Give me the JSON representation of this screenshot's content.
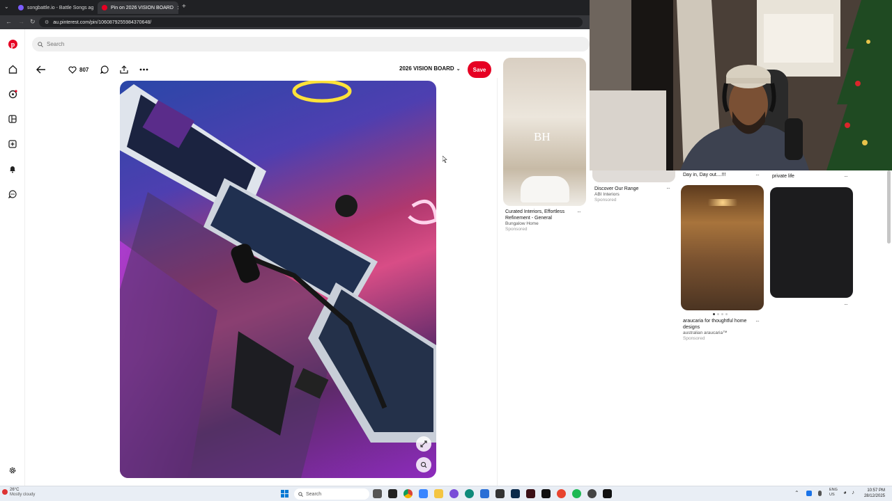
{
  "browser": {
    "tabs": [
      {
        "label": "songbattle.io - Battle Songs ag",
        "active": false,
        "favicon_color": "#7b5cff"
      },
      {
        "label": "Pin on 2026 VISION BOARD",
        "active": true,
        "favicon_color": "#e60023"
      }
    ],
    "url": "au.pinterest.com/pin/1060879255984370648/"
  },
  "search": {
    "placeholder": "Search"
  },
  "pin": {
    "likes": "807",
    "board_name": "2026 VISION BOARD",
    "save_label": "Save"
  },
  "feed": {
    "col1": {
      "title_line1": "Curated Interiors, Effortless",
      "title_line2": "Refinement - General",
      "source": "Bungalow Home",
      "sponsored": "Sponsored",
      "logo_text": "BH"
    },
    "col2": {
      "title": "Discover Our Range",
      "source": "ABI Interiors",
      "sponsored": "Sponsored"
    },
    "col3_top": {
      "title": "Day in, Day out....!!!"
    },
    "col4_top": {
      "title": "private life"
    },
    "col3": {
      "title_line1": "araucaria for thoughtful home",
      "title_line2": "designs",
      "source": "australian araucaria™",
      "sponsored": "Sponsored"
    }
  },
  "taskbar": {
    "weather_temp": "26°C",
    "weather_desc": "Mostly cloudy",
    "search_label": "Search",
    "lang_line1": "ENG",
    "lang_line2": "US",
    "time": "10:57 PM",
    "date": "28/12/2025"
  },
  "colors": {
    "brand": "#e60023"
  }
}
